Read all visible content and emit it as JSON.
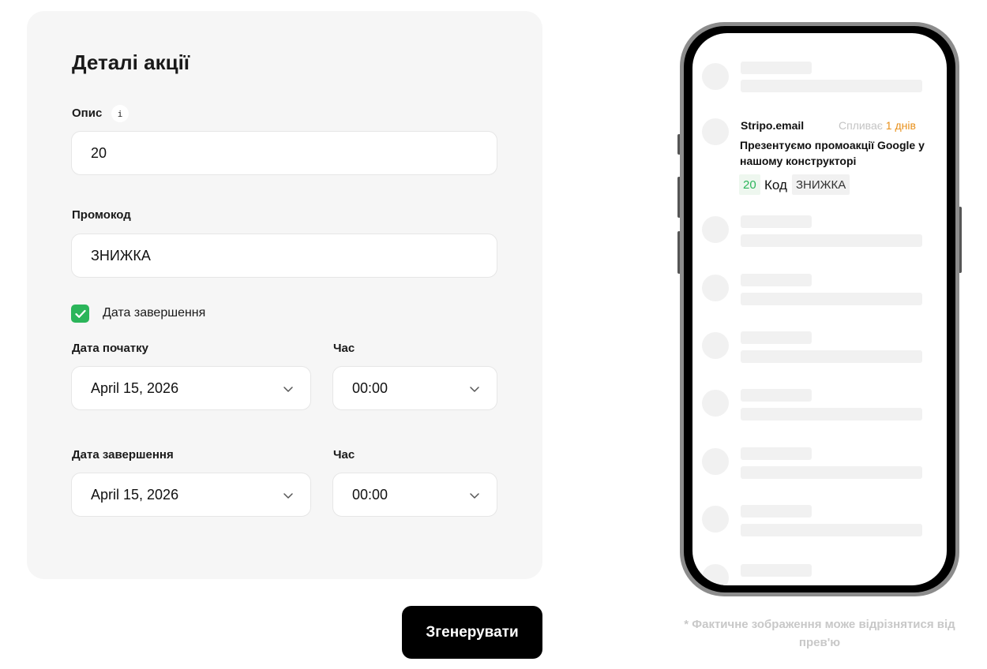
{
  "form": {
    "title": "Деталі акції",
    "description": {
      "label": "Опис",
      "info_icon": "i",
      "value": "20"
    },
    "promo_code": {
      "label": "Промокод",
      "value": "ЗНИЖКА"
    },
    "end_date_toggle": {
      "label": "Дата завершення",
      "checked": true
    },
    "start_date": {
      "label": "Дата початку",
      "value": "April 15, 2026"
    },
    "start_time": {
      "label": "Час",
      "value": "00:00"
    },
    "end_date": {
      "label": "Дата завершення",
      "value": "April 15, 2026"
    },
    "end_time": {
      "label": "Час",
      "value": "00:00"
    }
  },
  "generate_button": {
    "label": "Згенерувати"
  },
  "preview": {
    "sender": "Stripo.email",
    "expires_label": "Спливає",
    "expires_value": "1 днів",
    "title": "Презентуємо промоакції Google у нашому конструкторі",
    "discount": "20",
    "code_label": "Код",
    "code": "ЗНИЖКА"
  },
  "disclaimer": "* Фактичне зображення може відрізнятися від прев'ю",
  "colors": {
    "accent_green": "#2bb55a",
    "expire_orange": "#e8901a",
    "button_black": "#000000"
  }
}
